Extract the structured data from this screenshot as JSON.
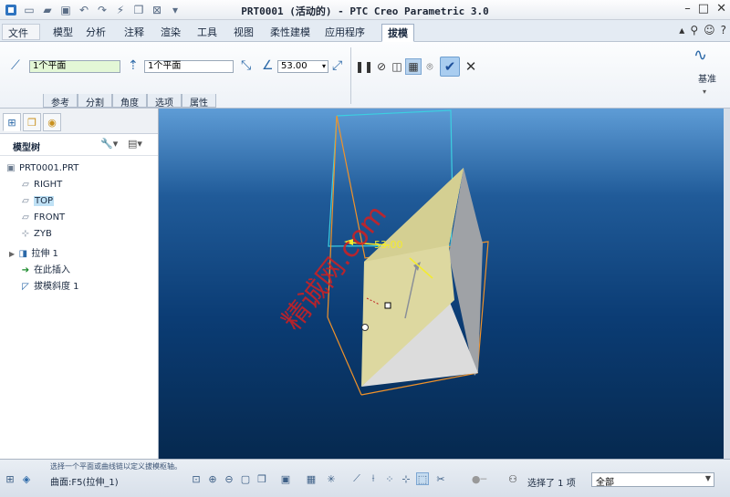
{
  "window": {
    "title": "PRT0001 (活动的) - PTC Creo Parametric 3.0"
  },
  "quick_access": {
    "icons": [
      "app-icon",
      "new-icon",
      "open-icon",
      "save-icon",
      "undo-icon",
      "redo-icon",
      "regenerate-icon",
      "windows-icon",
      "close-window-icon",
      "customize-icon"
    ]
  },
  "tabs": {
    "file": "文件",
    "items": [
      "模型",
      "分析",
      "注释",
      "渲染",
      "工具",
      "视图",
      "柔性建模",
      "应用程序",
      "拔模"
    ],
    "active": "拔模"
  },
  "ribbon": {
    "surface_field": "1个平面",
    "pull_direction_field": "1个平面",
    "angle_value": "53.00",
    "subtabs": [
      "参考",
      "分割",
      "角度",
      "选项",
      "属性"
    ],
    "datum_label": "基准"
  },
  "model_tree": {
    "header": "模型树",
    "items": [
      {
        "label": "PRT0001.PRT",
        "icon": "part-icon"
      },
      {
        "label": "RIGHT",
        "icon": "datum-plane-icon"
      },
      {
        "label": "TOP",
        "icon": "datum-plane-icon"
      },
      {
        "label": "FRONT",
        "icon": "datum-plane-icon"
      },
      {
        "label": "ZYB",
        "icon": "coordinate-system-icon"
      },
      {
        "label": "拉伸 1",
        "icon": "extrude-icon"
      },
      {
        "label": "在此插入",
        "icon": "insert-here-icon"
      },
      {
        "label": "拔模斜度 1",
        "icon": "draft-icon"
      }
    ]
  },
  "viewport": {
    "angle_dimension": "53.00",
    "watermark": "精诚网.com"
  },
  "status": {
    "message": "选择一个平面或曲线链以定义拔模枢轴。",
    "filter_text": "曲面:F5(拉伸_1)",
    "selection_info": "选择了 1 项",
    "selection_filter": "全部"
  },
  "colors": {
    "accent": "#2c69a8",
    "face_yellow": "#ddd8a0",
    "edge_orange": "#f0922a",
    "edge_cyan": "#3ccfe0"
  }
}
